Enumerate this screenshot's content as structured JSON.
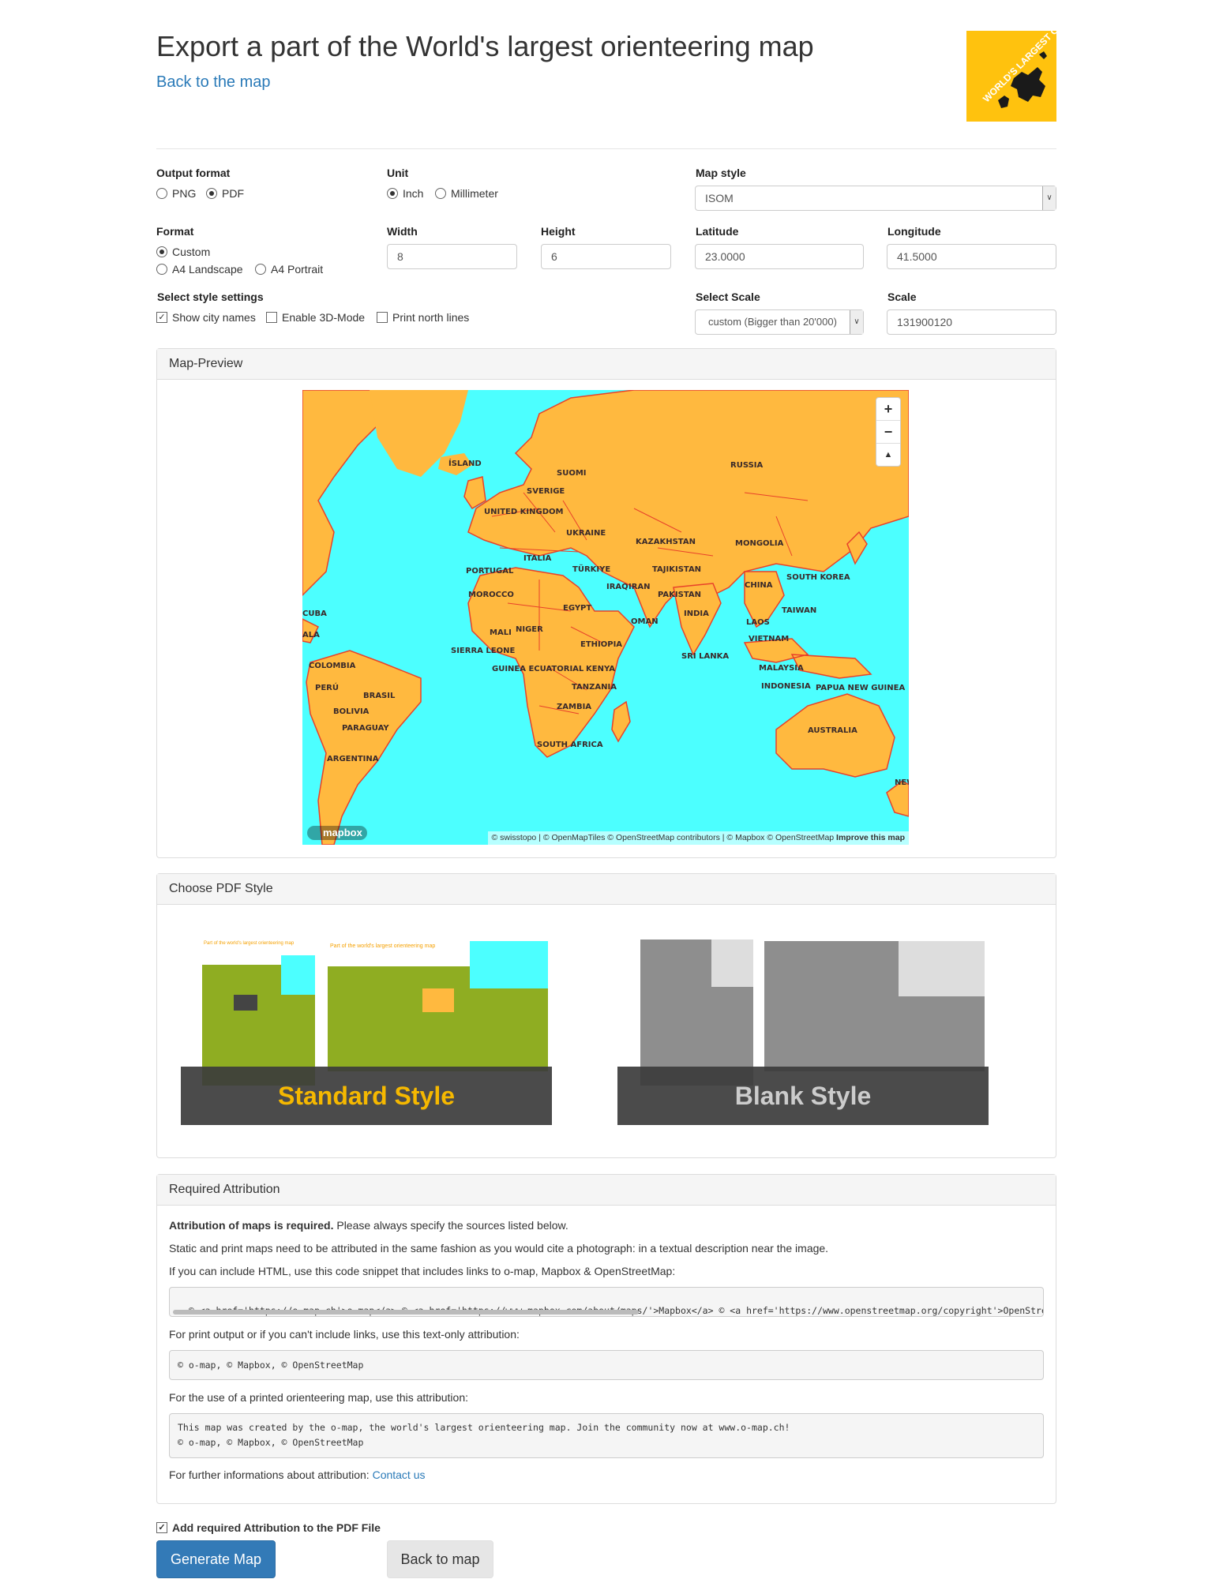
{
  "header": {
    "title": "Export a part of the World's largest orienteering map",
    "back_link": "Back to the map",
    "logo_text": "WORLD'S LARGEST ORIENTEERING MAP"
  },
  "form": {
    "output_format": {
      "label": "Output format",
      "options": [
        "PNG",
        "PDF"
      ],
      "selected": "PDF"
    },
    "unit": {
      "label": "Unit",
      "options": [
        "Inch",
        "Millimeter"
      ],
      "selected": "Inch"
    },
    "map_style": {
      "label": "Map style",
      "value": "ISOM"
    },
    "format": {
      "label": "Format",
      "options": [
        "Custom",
        "A4 Landscape",
        "A4 Portrait"
      ],
      "selected": "Custom"
    },
    "width": {
      "label": "Width",
      "value": "8"
    },
    "height": {
      "label": "Height",
      "value": "6"
    },
    "latitude": {
      "label": "Latitude",
      "value": "23.0000"
    },
    "longitude": {
      "label": "Longitude",
      "value": "41.5000"
    },
    "style_settings": {
      "label": "Select style settings",
      "options": [
        {
          "label": "Show city names",
          "checked": true
        },
        {
          "label": "Enable 3D-Mode",
          "checked": false
        },
        {
          "label": "Print north lines",
          "checked": false
        }
      ]
    },
    "select_scale": {
      "label": "Select Scale",
      "value": "custom (Bigger than 20'000)"
    },
    "scale": {
      "label": "Scale",
      "value": "131900120"
    }
  },
  "map_preview": {
    "title": "Map-Preview",
    "zoom_in": "+",
    "zoom_out": "−",
    "compass": "▲",
    "mapbox_logo": "mapbox",
    "attribution": "© swisstopo | © OpenMapTiles © OpenStreetMap contributors | © Mapbox © OpenStreetMap",
    "improve": "Improve this map",
    "labels": [
      "ÍSLAND",
      "SUOMI",
      "RUSSIA",
      "SVERIGE",
      "UNITED KINGDOM",
      "UKRAINE",
      "KAZAKHSTAN",
      "MONGOLIA",
      "ITALIA",
      "PORTUGAL",
      "TÜRKIYE",
      "TAJIKISTAN",
      "SOUTH KOREA",
      "CHINA",
      "MOROCCO",
      "IRAQ",
      "IRAN",
      "PAKISTAN",
      "EGYPT",
      "TAIWAN",
      "INDIA",
      "OMAN",
      "LAOS",
      "CUBA",
      "MALI",
      "NIGER",
      "VIETNAM",
      "ALA",
      "ETHIOPIA",
      "SIERRA LEONE",
      "SRI LANKA",
      "COLOMBIA",
      "GUINEA ECUATORIAL",
      "KENYA",
      "MALAYSIA",
      "PERÚ",
      "INDONESIA",
      "PAPUA NEW GUINEA",
      "BRASIL",
      "TANZANIA",
      "BOLIVIA",
      "ZAMBIA",
      "PARAGUAY",
      "AUSTRALIA",
      "SOUTH AFRICA",
      "ARGENTINA",
      "NEW"
    ],
    "colors": {
      "sea": "#4cffff",
      "land": "#ffb93f",
      "border": "#e8412a"
    }
  },
  "pdf_style": {
    "title": "Choose PDF Style",
    "standard_label": "Standard Style",
    "blank_label": "Blank Style",
    "thumb_title": "Part of the world's largest orienteering map",
    "colors": {
      "accent": "#f5b800",
      "green": "#8fad22"
    }
  },
  "attribution": {
    "title": "Required Attribution",
    "bold_intro": "Attribution of maps is required.",
    "intro_rest": " Please always specify the sources listed below.",
    "line2": "Static and print maps need to be attributed in the same fashion as you would cite a photograph: in a textual description near the image.",
    "line3": "If you can include HTML, use this code snippet that includes links to o-map, Mapbox & OpenStreetMap:",
    "html_snippet": "© <a href='https://o-map.ch'>o-map</a> © <a href='https://www.mapbox.com/about/maps/'>Mapbox</a> © <a href='https://www.openstreetmap.org/copyright'>OpenStreetMap</a>",
    "line4": "For print output or if you can't include links, use this text-only attribution:",
    "text_snippet": "© o-map, © Mapbox, © OpenStreetMap",
    "line5": "For the use of a printed orienteering map, use this attribution:",
    "print_snippet_1": "This map was created by the o-map, the world's largest orienteering map. Join the community now at www.o-map.ch!",
    "print_snippet_2": "© o-map, © Mapbox, © OpenStreetMap",
    "line6": "For further informations about attribution: ",
    "contact": "Contact us"
  },
  "footer": {
    "add_attribution": "Add required Attribution to the PDF File",
    "generate": "Generate Map",
    "back": "Back to map"
  },
  "colors": {
    "link": "#2a7ab8",
    "primary": "#337ab7",
    "logo": "#ffc20e"
  }
}
